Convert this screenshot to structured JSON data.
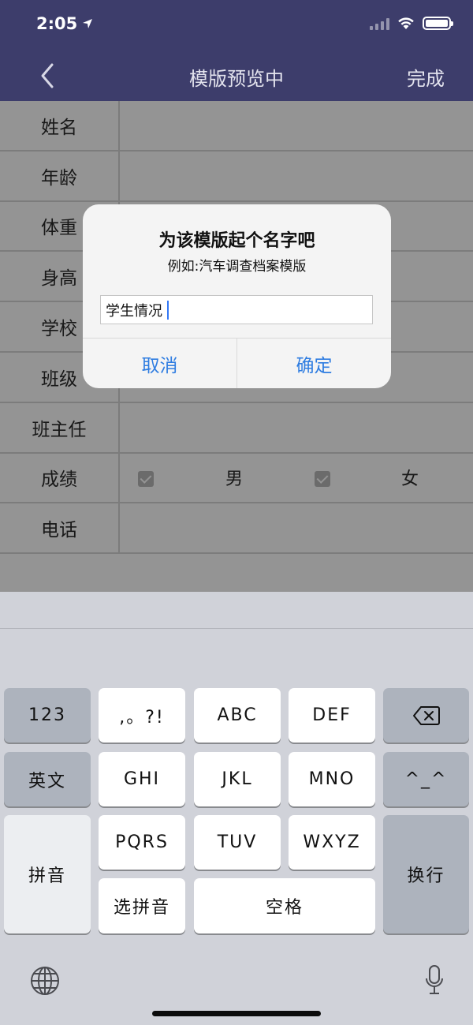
{
  "status": {
    "time": "2:05"
  },
  "nav": {
    "title": "模版预览中",
    "done": "完成"
  },
  "form": {
    "rows": [
      "姓名",
      "年龄",
      "体重",
      "身高",
      "学校",
      "班级",
      "班主任",
      "成绩",
      "电话"
    ],
    "gender_options": [
      "男",
      "女"
    ]
  },
  "alert": {
    "title": "为该模版起个名字吧",
    "message": "例如:汽车调查档案模版",
    "input_value": "学生情况",
    "cancel": "取消",
    "confirm": "确定"
  },
  "keyboard": {
    "row1": [
      "123",
      ",。?!",
      "ABC",
      "DEF"
    ],
    "row2": [
      "英文",
      "GHI",
      "JKL",
      "MNO",
      "^_^"
    ],
    "row3": [
      "PQRS",
      "TUV",
      "WXYZ"
    ],
    "pinyin": "拼音",
    "newline": "换行",
    "select_pinyin": "选拼音",
    "space": "空格",
    "icons": [
      "delete-icon",
      "globe-icon",
      "microphone-icon"
    ]
  },
  "colors": {
    "nav_bg": "#3d3d6b",
    "accent": "#2f7de1"
  }
}
